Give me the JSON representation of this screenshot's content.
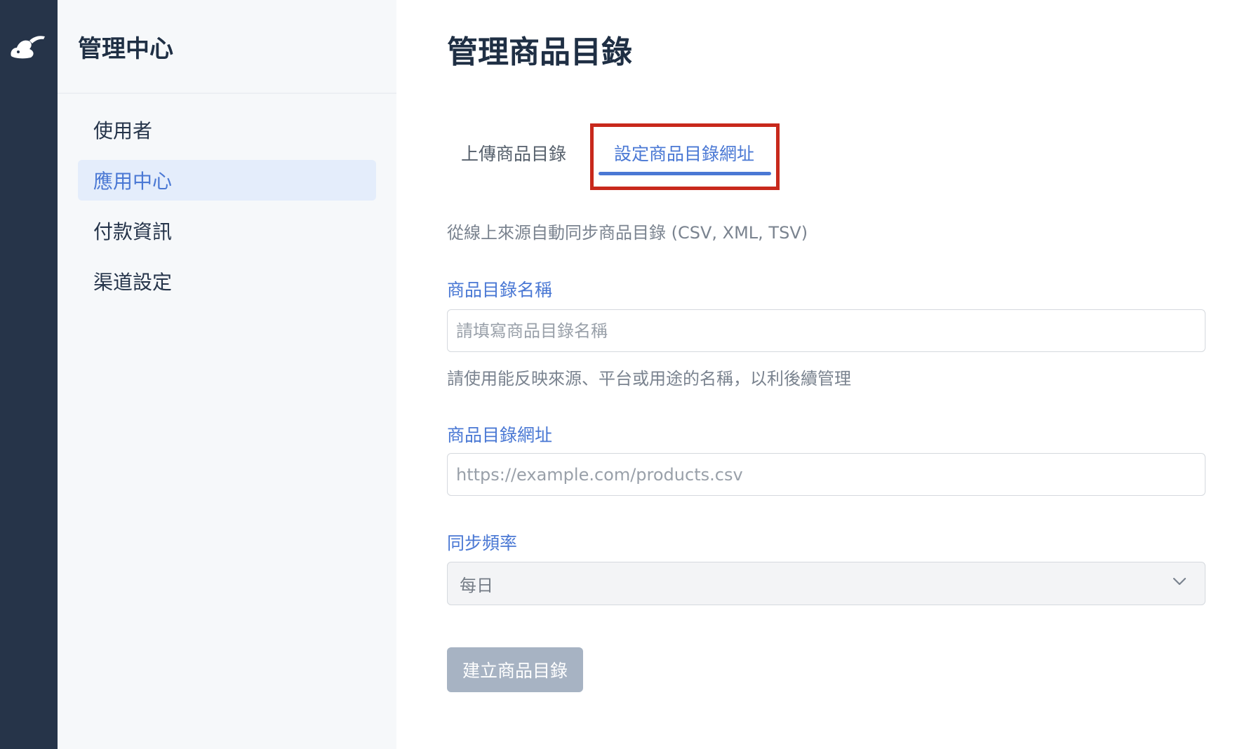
{
  "sidebar": {
    "title": "管理中心",
    "items": [
      {
        "label": "使用者"
      },
      {
        "label": "應用中心"
      },
      {
        "label": "付款資訊"
      },
      {
        "label": "渠道設定"
      }
    ]
  },
  "main": {
    "title": "管理商品目錄",
    "tabs": [
      {
        "label": "上傳商品目錄"
      },
      {
        "label": "設定商品目錄網址"
      }
    ],
    "description": "從線上來源自動同步商品目錄 (CSV, XML, TSV)",
    "form": {
      "name_label": "商品目錄名稱",
      "name_placeholder": "請填寫商品目錄名稱",
      "name_hint": "請使用能反映來源、平台或用途的名稱，以利後續管理",
      "url_label": "商品目錄網址",
      "url_placeholder": "https://example.com/products.csv",
      "frequency_label": "同步頻率",
      "frequency_value": "每日",
      "submit_label": "建立商品目錄"
    }
  },
  "colors": {
    "rail": "#263449",
    "accent": "#4a78d4",
    "highlight": "#c8291c",
    "button_disabled": "#a7b3c3"
  },
  "icons": {
    "logo": "brand-logo-icon",
    "chevron": "chevron-down-icon"
  }
}
